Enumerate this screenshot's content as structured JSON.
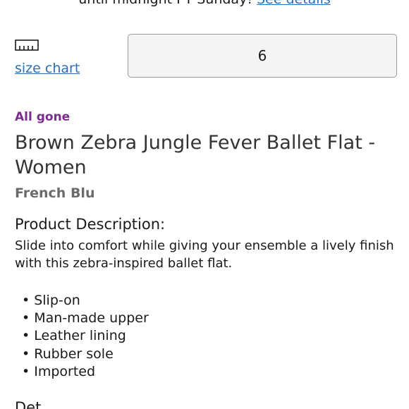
{
  "promo": {
    "text": "until midnight PT Sunday!",
    "link": "See details"
  },
  "size": {
    "icon": "ruler-icon",
    "chart_link": "size chart",
    "quantity_value": "6"
  },
  "product": {
    "status": "All gone",
    "title": "Brown Zebra Jungle Fever Ballet Flat - Women",
    "brand": "French Blu",
    "description_heading": "Product Description:",
    "description": "Slide into comfort while giving your ensemble a lively finish with this zebra-inspired ballet flat.",
    "features": [
      "Slip-on",
      "Man-made upper",
      "Leather lining",
      "Rubber sole",
      "Imported"
    ],
    "cut_off_heading": "Det"
  },
  "colors": {
    "link": "#2a6fb5",
    "status": "#7b2d8e",
    "brand": "#6b6b6b"
  }
}
